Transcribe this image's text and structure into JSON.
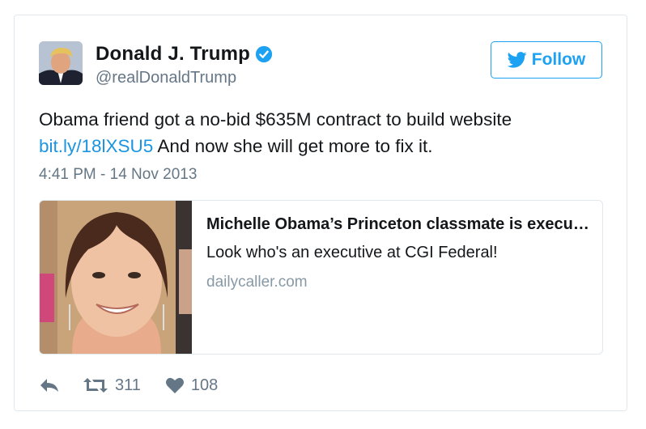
{
  "tweet": {
    "display_name": "Donald J. Trump",
    "handle": "@realDonaldTrump",
    "follow_label": "Follow",
    "text_before_link": "Obama friend got a no-bid $635M contract to build website ",
    "link_text": "bit.ly/18lXSU5",
    "text_after_link": " And now she will get more to fix it.",
    "timestamp": "4:41 PM - 14 Nov 2013"
  },
  "card_preview": {
    "title": "Michelle Obama’s Princeton classmate is executive at CGI Federal",
    "description": "Look who's an executive at CGI Federal!",
    "domain": "dailycaller.com"
  },
  "actions": {
    "retweet_count": "311",
    "like_count": "108"
  },
  "colors": {
    "accent": "#1da1f2",
    "link": "#1b95e0",
    "muted": "#657786",
    "border": "#e1e8ed"
  },
  "icons": [
    "verified-icon",
    "twitter-bird-icon",
    "reply-icon",
    "retweet-icon",
    "heart-icon"
  ]
}
